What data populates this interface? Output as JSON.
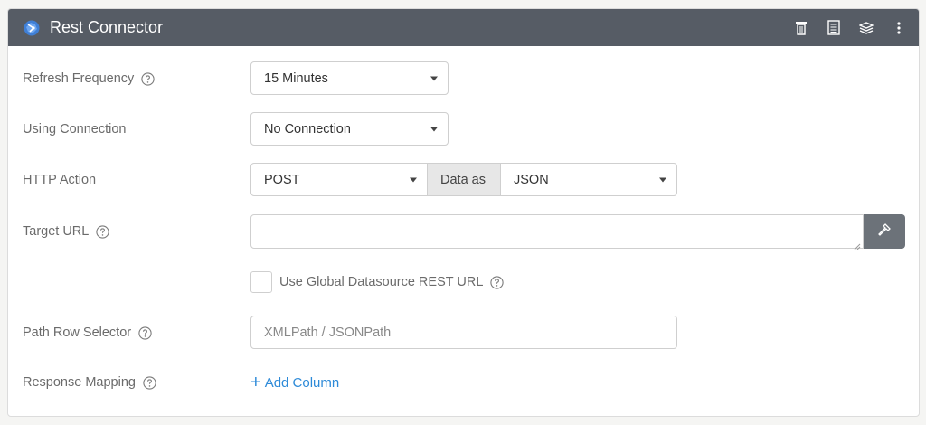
{
  "header": {
    "title": "Rest Connector",
    "actions": [
      "delete-icon",
      "document-icon",
      "layers-icon",
      "more-vertical-icon"
    ]
  },
  "form": {
    "refresh_frequency": {
      "label": "Refresh Frequency",
      "value": "15 Minutes"
    },
    "using_connection": {
      "label": "Using Connection",
      "value": "No Connection"
    },
    "http_action": {
      "label": "HTTP Action",
      "value": "POST",
      "data_as_label": "Data as",
      "data_as_value": "JSON"
    },
    "target_url": {
      "label": "Target URL",
      "value": ""
    },
    "global_datasource": {
      "label": "Use Global Datasource REST URL",
      "checked": false
    },
    "path_row_selector": {
      "label": "Path Row Selector",
      "placeholder": "XMLPath / JSONPath"
    },
    "response_mapping": {
      "label": "Response Mapping",
      "add_column": "Add Column"
    }
  },
  "colors": {
    "header_bg": "#565c65",
    "accent": "#2d8ad8",
    "button_bg": "#6c7279"
  }
}
